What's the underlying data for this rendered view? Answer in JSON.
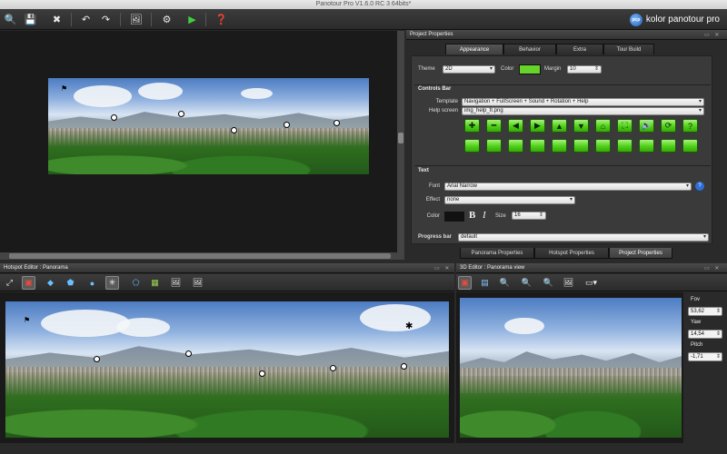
{
  "window": {
    "title": "Panotour Pro V1.6.0 RC 3 64bits*"
  },
  "brand": {
    "logo": "pcp",
    "name": "kolor panotour pro"
  },
  "toolbar": {
    "icons": [
      "tour-search-icon",
      "save-icon",
      "delete-tour-icon",
      "undo-icon",
      "redo-icon",
      "add-panorama-icon",
      "settings-icon",
      "play-icon",
      "help-icon"
    ]
  },
  "project_properties": {
    "title": "Project Properties",
    "tabs": [
      "Appearance",
      "Behavior",
      "Extra",
      "Tour Build"
    ],
    "active_tab": "Appearance",
    "theme_label": "Theme",
    "theme_value": "2D",
    "color_label": "Color",
    "color_value": "#66d42a",
    "margin_label": "Margin",
    "margin_value": "10",
    "controls_bar": {
      "section": "Controls Bar",
      "template_label": "Template",
      "template_value": "Navigation + FullScreen + Sound + Rotation + Help",
      "help_label": "Help screen",
      "help_value": "img_help_fr.png",
      "buttons": [
        "✚",
        "━",
        "◀",
        "▶",
        "▲",
        "▼",
        "⌂",
        "⛶",
        "🔊",
        "⟳",
        "?"
      ]
    },
    "text": {
      "section": "Text",
      "font_label": "Font",
      "font_value": "Arial Narrow",
      "effect_label": "Effect",
      "effect_value": "none",
      "color_label": "Color",
      "color_value": "#111111",
      "bold": "B",
      "italic": "I",
      "size_label": "Size",
      "size_value": "16"
    },
    "progress": {
      "label": "Progress bar",
      "value": "default"
    },
    "bottom_tabs": [
      "Panorama Properties",
      "Hotspot Properties",
      "Project Properties"
    ],
    "bottom_active": "Project Properties"
  },
  "hotspot_editor": {
    "title": "Hotspot Editor : Panorama"
  },
  "view_3d": {
    "title": "3D Editor : Panorama view",
    "fov_label": "Fov",
    "fov_value": "53,62",
    "yaw_label": "Yaw",
    "yaw_value": "14,54",
    "pitch_label": "Pitch",
    "pitch_value": "-1,71"
  },
  "colors": {
    "accent_green": "#66d42a",
    "panel_bg": "#1a1a1a"
  }
}
